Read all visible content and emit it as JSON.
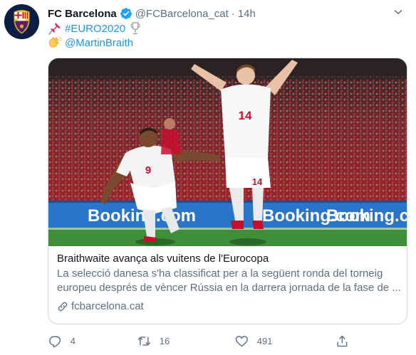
{
  "tweet": {
    "display_name": "FC Barcelona",
    "handle": "@FCBarcelona_cat",
    "separator": "·",
    "time": "14h",
    "line1": {
      "emoji": "pushpin",
      "hashtag": "#EURO2020",
      "trailing_emoji": "trophy"
    },
    "line2": {
      "emoji": "clapping-hands",
      "mention": "@MartinBraith"
    }
  },
  "card": {
    "title": "Braithwaite avança als vuitens de l'Eurocopa",
    "description_line1": "La selecció danesa s'ha classificat per a la següent ronda del torneig",
    "description_line2": "europeu després de vèncer Rússia en la darrera jornada de la fase de ...",
    "domain": "fcbarcelona.cat",
    "image": {
      "banner_text": "Booking.com",
      "player_left_number": "9",
      "player_right_number": "14"
    }
  },
  "actions": {
    "reply_count": "4",
    "retweet_count": "16",
    "like_count": "491",
    "share_count": ""
  },
  "colors": {
    "link": "#1b95e0",
    "secondary_text": "#5b7083",
    "verified": "#1da1f2",
    "pitch": "#3f8f3a",
    "crowd": "#b3202a",
    "banner": "#2a74c9"
  }
}
